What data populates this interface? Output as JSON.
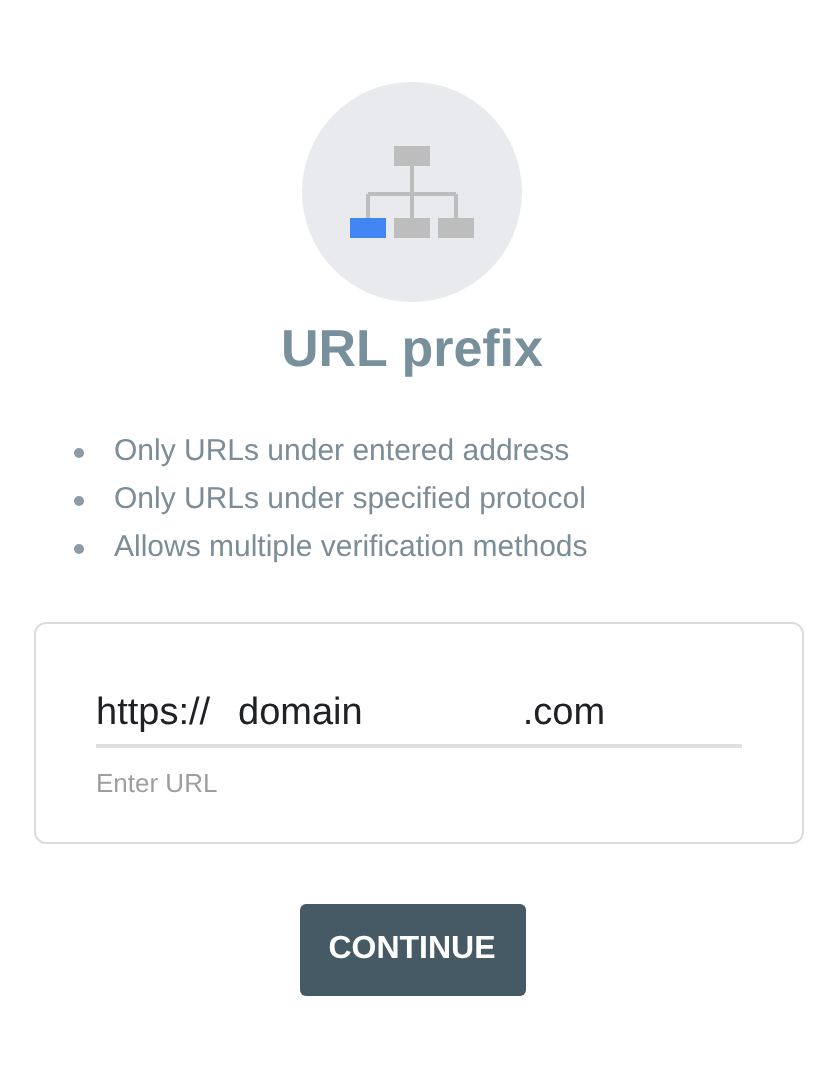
{
  "title": "URL prefix",
  "features": [
    "Only URLs under entered address",
    "Only URLs under specified protocol",
    "Allows multiple verification methods"
  ],
  "url_field": {
    "value_parts": [
      "https://",
      "domain",
      ".com"
    ],
    "helper": "Enter URL"
  },
  "button": "CONTINUE"
}
